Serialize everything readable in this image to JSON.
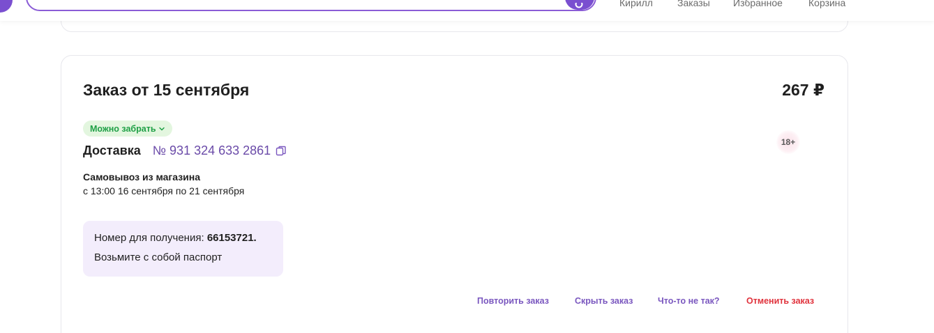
{
  "header": {
    "nav": [
      {
        "label": "Кирилл"
      },
      {
        "label": "Заказы"
      },
      {
        "label": "Избранное"
      },
      {
        "label": "Корзина"
      }
    ]
  },
  "order": {
    "title": "Заказ от 15 сентября",
    "price": "267 ₽",
    "status": "Можно забрать",
    "delivery_label": "Доставка",
    "number": "№ 931 324 633 2861",
    "age_label": "18+",
    "pickup_title": "Самовывоз из магазина",
    "pickup_time": "с 13:00 16 сентября по 21 сентября",
    "receive_prefix": "Номер для получения: ",
    "receive_code": "66153721.",
    "passport_note": "Возьмите с собой паспорт"
  },
  "actions": {
    "repeat": "Повторить заказ",
    "hide": "Скрыть заказ",
    "problem": "Что-то не так?",
    "cancel": "Отменить заказ"
  },
  "colors": {
    "accent": "#7a4fd0",
    "status_green": "#1fa046",
    "status_bg": "#e3f6df",
    "cancel_red": "#e0323c",
    "info_bg": "#f3edfc"
  },
  "icons": {
    "search": "search-icon",
    "copy": "copy-icon",
    "chevron": "chevron-down-icon"
  }
}
